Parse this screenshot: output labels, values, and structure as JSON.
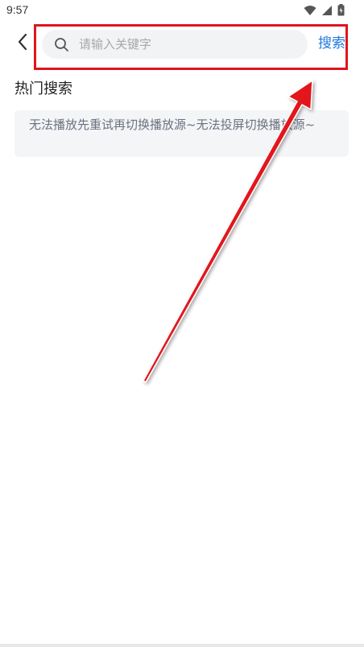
{
  "status_bar": {
    "time": "9:57",
    "icons": [
      "wifi-icon",
      "signal-icon",
      "battery-icon"
    ]
  },
  "header": {
    "back_icon": "chevron-left-icon",
    "search_icon": "search-icon",
    "search_placeholder": "请输入关键字",
    "search_value": "",
    "search_button_label": "搜索"
  },
  "hot_search": {
    "title": "热门搜索",
    "items": [
      {
        "label": "无法播放先重试再切换播放源~无法投屏切换播放源~"
      }
    ]
  },
  "colors": {
    "accent": "#1e78e0",
    "annotation_red": "#e0141c",
    "search_bg": "#f2f3f5",
    "tag_bg": "#f4f5f7"
  }
}
